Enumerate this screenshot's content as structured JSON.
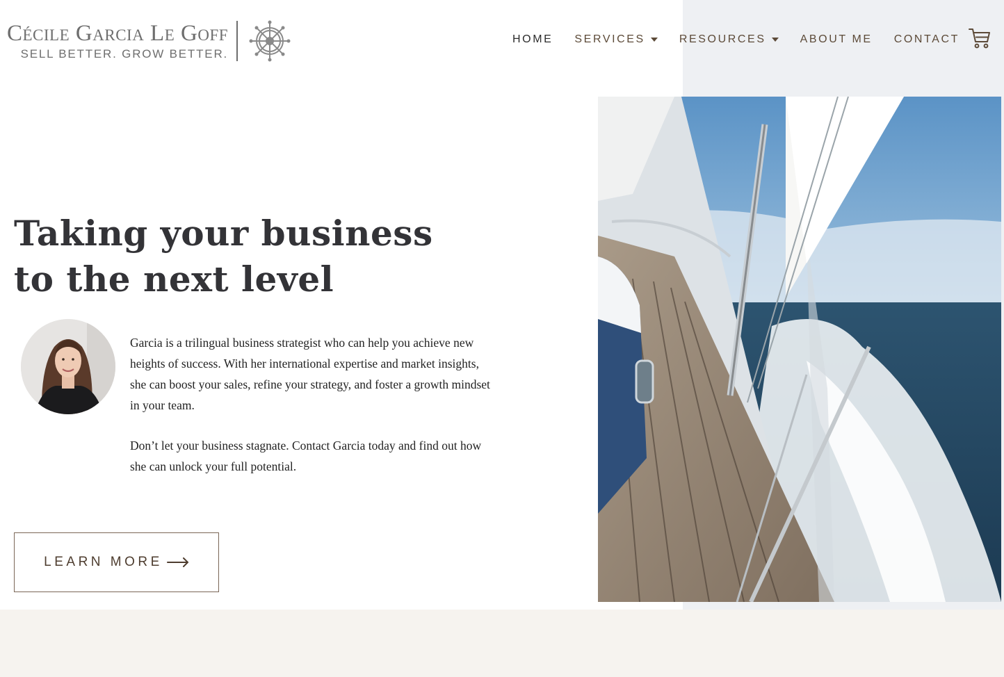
{
  "brand": {
    "name": "Cécile Garcia Le Goff",
    "tagline": "SELL BETTER. GROW BETTER.",
    "emblem_icon": "ship-wheel-icon"
  },
  "nav": {
    "items": [
      {
        "label": "HOME",
        "active": true,
        "dropdown": false
      },
      {
        "label": "SERVICES",
        "active": false,
        "dropdown": true
      },
      {
        "label": "RESOURCES",
        "active": false,
        "dropdown": true
      },
      {
        "label": "ABOUT ME",
        "active": false,
        "dropdown": false
      },
      {
        "label": "CONTACT",
        "active": false,
        "dropdown": false
      }
    ],
    "cart_icon": "shopping-cart-icon"
  },
  "hero": {
    "title_line1": "Taking your business",
    "title_line2": "to the next level",
    "paragraph1": "Garcia is a trilingual business strategist who can help you achieve new heights of success. With her international expertise and market insights, she can boost your sales, refine your strategy, and foster a growth mindset in your team.",
    "paragraph2": "Don’t let your business stagnate. Contact Garcia today and find out how she can unlock your full potential.",
    "cta_label": "LEARN MORE",
    "cta_icon": "arrow-right-icon"
  },
  "colors": {
    "accent_brown": "#5c4a38",
    "heading": "#333337",
    "panel_gray": "#eef0f3",
    "band_cream": "#f6f3ef"
  }
}
